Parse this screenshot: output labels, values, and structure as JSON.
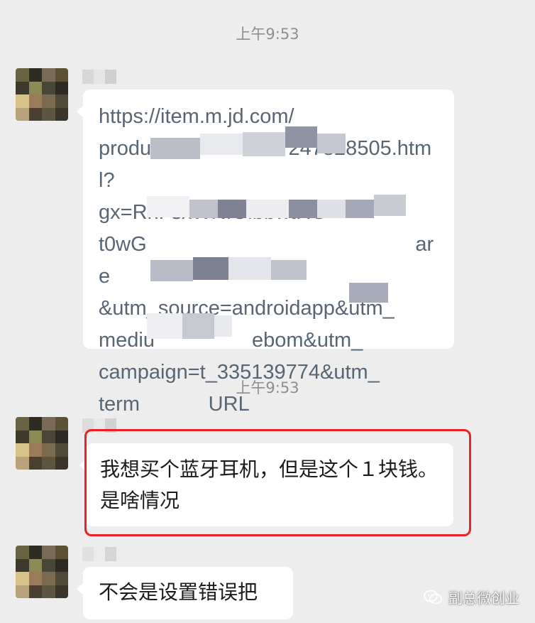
{
  "messages": [
    {
      "timestamp": "上午9:53",
      "type": "link",
      "text": "https://item.m.jd.com/\nprodu                        2478​28505.html?\ngx=RnFsxWNfOibbwtRG\nt0wG                                               are\n&utm_source=androidapp&utm_\nmediu                 ebom&utm_\ncampaign=t_335139774&utm_\nterm            URL"
    },
    {
      "timestamp": "上午9:53",
      "type": "text",
      "text": "我想买个蓝牙耳机，但是这个１块钱。是啥情况",
      "highlighted": true
    },
    {
      "type": "text",
      "text": "不会是设置错误把"
    }
  ],
  "watermark": {
    "icon": "wechat-official-account-icon",
    "label": "副总微创业"
  },
  "colors": {
    "background": "#ededed",
    "bubble": "#ffffff",
    "link_text": "#586574",
    "timestamp": "#8e8e8e",
    "highlight": "#e8222b"
  }
}
